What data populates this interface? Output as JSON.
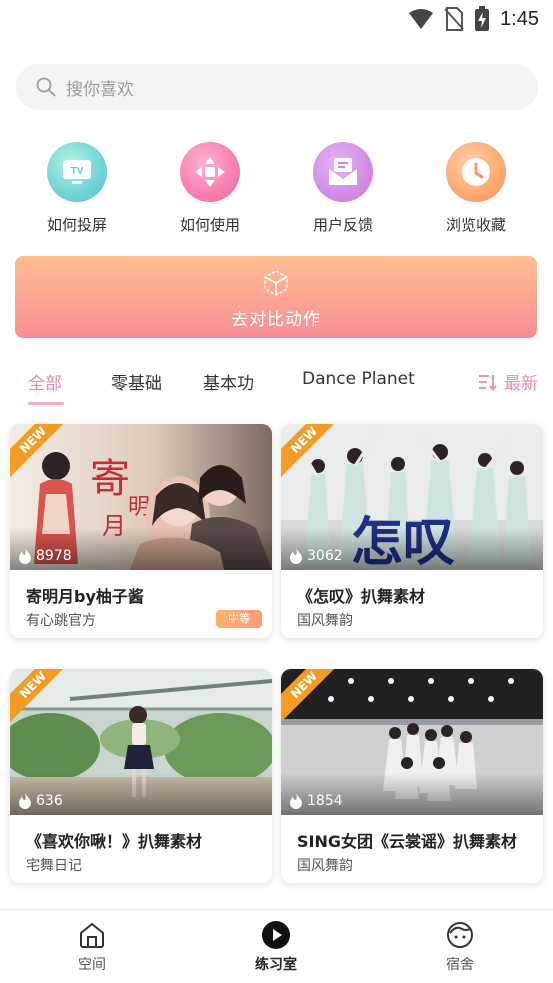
{
  "status_bar": {
    "time": "1:45"
  },
  "search": {
    "placeholder": "搜你喜欢"
  },
  "quick_actions": [
    {
      "label": "如何投屏",
      "icon": "tv-icon"
    },
    {
      "label": "如何使用",
      "icon": "dpad-icon"
    },
    {
      "label": "用户反馈",
      "icon": "mail-icon"
    },
    {
      "label": "浏览收藏",
      "icon": "clock-icon"
    }
  ],
  "banner": {
    "label": "去对比动作",
    "icon": "cube-icon"
  },
  "tabs": [
    "全部",
    "零基础",
    "基本功",
    "Dance Planet"
  ],
  "active_tab": "全部",
  "sort": {
    "label": "最新",
    "icon": "sort-icon"
  },
  "cards": [
    {
      "title": "寄明月by柚子酱",
      "subtitle": "有心跳官方",
      "views": "8978",
      "badge": "NEW",
      "level": "中等"
    },
    {
      "title": "《怎叹》扒舞素材",
      "subtitle": "国风舞韵",
      "views": "3062",
      "badge": "NEW",
      "overlay_text": "怎叹"
    },
    {
      "title": "《喜欢你啾！》扒舞素材",
      "subtitle": "宅舞日记",
      "views": "636",
      "badge": "NEW"
    },
    {
      "title": "SING女团《云裳谣》扒舞素材",
      "subtitle": "国风舞韵",
      "views": "1854",
      "badge": "NEW"
    }
  ],
  "nav": [
    {
      "label": "空间",
      "icon": "home-icon"
    },
    {
      "label": "练习室",
      "icon": "play-icon"
    },
    {
      "label": "宿舍",
      "icon": "face-icon"
    }
  ],
  "colors": {
    "accent": "#f28aa1",
    "new_badge": "#f39c24",
    "banner_start": "#ffbf90",
    "banner_end": "#f88e94"
  }
}
